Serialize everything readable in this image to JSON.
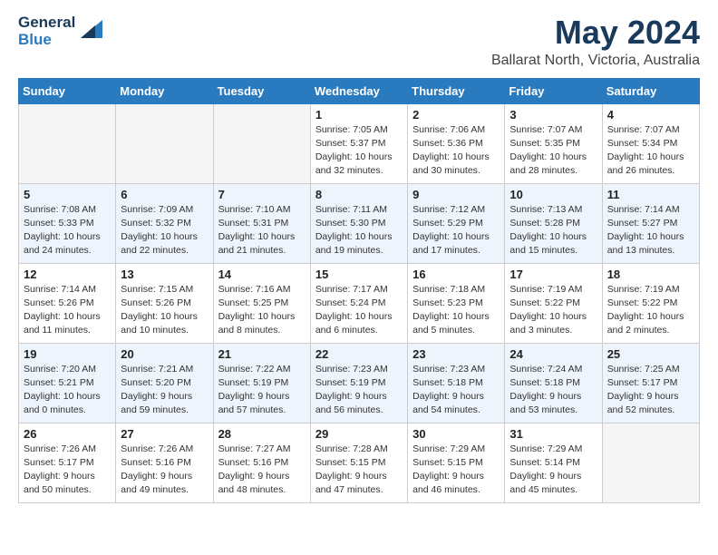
{
  "logo": {
    "general": "General",
    "blue": "Blue"
  },
  "title": "May 2024",
  "subtitle": "Ballarat North, Victoria, Australia",
  "days_of_week": [
    "Sunday",
    "Monday",
    "Tuesday",
    "Wednesday",
    "Thursday",
    "Friday",
    "Saturday"
  ],
  "weeks": [
    [
      {
        "num": "",
        "info": ""
      },
      {
        "num": "",
        "info": ""
      },
      {
        "num": "",
        "info": ""
      },
      {
        "num": "1",
        "info": "Sunrise: 7:05 AM\nSunset: 5:37 PM\nDaylight: 10 hours\nand 32 minutes."
      },
      {
        "num": "2",
        "info": "Sunrise: 7:06 AM\nSunset: 5:36 PM\nDaylight: 10 hours\nand 30 minutes."
      },
      {
        "num": "3",
        "info": "Sunrise: 7:07 AM\nSunset: 5:35 PM\nDaylight: 10 hours\nand 28 minutes."
      },
      {
        "num": "4",
        "info": "Sunrise: 7:07 AM\nSunset: 5:34 PM\nDaylight: 10 hours\nand 26 minutes."
      }
    ],
    [
      {
        "num": "5",
        "info": "Sunrise: 7:08 AM\nSunset: 5:33 PM\nDaylight: 10 hours\nand 24 minutes."
      },
      {
        "num": "6",
        "info": "Sunrise: 7:09 AM\nSunset: 5:32 PM\nDaylight: 10 hours\nand 22 minutes."
      },
      {
        "num": "7",
        "info": "Sunrise: 7:10 AM\nSunset: 5:31 PM\nDaylight: 10 hours\nand 21 minutes."
      },
      {
        "num": "8",
        "info": "Sunrise: 7:11 AM\nSunset: 5:30 PM\nDaylight: 10 hours\nand 19 minutes."
      },
      {
        "num": "9",
        "info": "Sunrise: 7:12 AM\nSunset: 5:29 PM\nDaylight: 10 hours\nand 17 minutes."
      },
      {
        "num": "10",
        "info": "Sunrise: 7:13 AM\nSunset: 5:28 PM\nDaylight: 10 hours\nand 15 minutes."
      },
      {
        "num": "11",
        "info": "Sunrise: 7:14 AM\nSunset: 5:27 PM\nDaylight: 10 hours\nand 13 minutes."
      }
    ],
    [
      {
        "num": "12",
        "info": "Sunrise: 7:14 AM\nSunset: 5:26 PM\nDaylight: 10 hours\nand 11 minutes."
      },
      {
        "num": "13",
        "info": "Sunrise: 7:15 AM\nSunset: 5:26 PM\nDaylight: 10 hours\nand 10 minutes."
      },
      {
        "num": "14",
        "info": "Sunrise: 7:16 AM\nSunset: 5:25 PM\nDaylight: 10 hours\nand 8 minutes."
      },
      {
        "num": "15",
        "info": "Sunrise: 7:17 AM\nSunset: 5:24 PM\nDaylight: 10 hours\nand 6 minutes."
      },
      {
        "num": "16",
        "info": "Sunrise: 7:18 AM\nSunset: 5:23 PM\nDaylight: 10 hours\nand 5 minutes."
      },
      {
        "num": "17",
        "info": "Sunrise: 7:19 AM\nSunset: 5:22 PM\nDaylight: 10 hours\nand 3 minutes."
      },
      {
        "num": "18",
        "info": "Sunrise: 7:19 AM\nSunset: 5:22 PM\nDaylight: 10 hours\nand 2 minutes."
      }
    ],
    [
      {
        "num": "19",
        "info": "Sunrise: 7:20 AM\nSunset: 5:21 PM\nDaylight: 10 hours\nand 0 minutes."
      },
      {
        "num": "20",
        "info": "Sunrise: 7:21 AM\nSunset: 5:20 PM\nDaylight: 9 hours\nand 59 minutes."
      },
      {
        "num": "21",
        "info": "Sunrise: 7:22 AM\nSunset: 5:19 PM\nDaylight: 9 hours\nand 57 minutes."
      },
      {
        "num": "22",
        "info": "Sunrise: 7:23 AM\nSunset: 5:19 PM\nDaylight: 9 hours\nand 56 minutes."
      },
      {
        "num": "23",
        "info": "Sunrise: 7:23 AM\nSunset: 5:18 PM\nDaylight: 9 hours\nand 54 minutes."
      },
      {
        "num": "24",
        "info": "Sunrise: 7:24 AM\nSunset: 5:18 PM\nDaylight: 9 hours\nand 53 minutes."
      },
      {
        "num": "25",
        "info": "Sunrise: 7:25 AM\nSunset: 5:17 PM\nDaylight: 9 hours\nand 52 minutes."
      }
    ],
    [
      {
        "num": "26",
        "info": "Sunrise: 7:26 AM\nSunset: 5:17 PM\nDaylight: 9 hours\nand 50 minutes."
      },
      {
        "num": "27",
        "info": "Sunrise: 7:26 AM\nSunset: 5:16 PM\nDaylight: 9 hours\nand 49 minutes."
      },
      {
        "num": "28",
        "info": "Sunrise: 7:27 AM\nSunset: 5:16 PM\nDaylight: 9 hours\nand 48 minutes."
      },
      {
        "num": "29",
        "info": "Sunrise: 7:28 AM\nSunset: 5:15 PM\nDaylight: 9 hours\nand 47 minutes."
      },
      {
        "num": "30",
        "info": "Sunrise: 7:29 AM\nSunset: 5:15 PM\nDaylight: 9 hours\nand 46 minutes."
      },
      {
        "num": "31",
        "info": "Sunrise: 7:29 AM\nSunset: 5:14 PM\nDaylight: 9 hours\nand 45 minutes."
      },
      {
        "num": "",
        "info": ""
      }
    ]
  ]
}
